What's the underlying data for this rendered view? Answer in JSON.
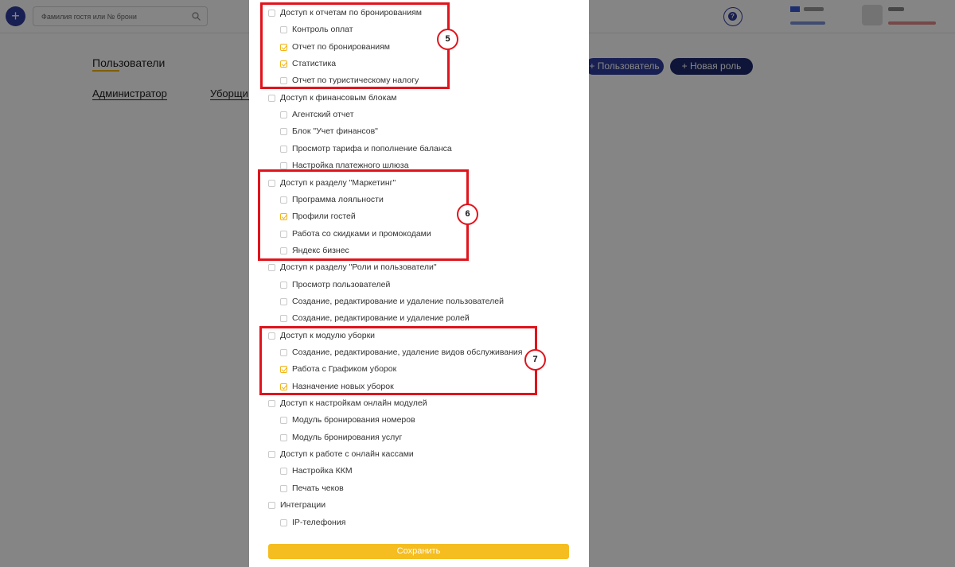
{
  "header": {
    "add_button": "+",
    "search_placeholder": "Фамилия гостя или № брони",
    "help_icon": "?"
  },
  "background": {
    "page_title": "Пользователи",
    "tabs": [
      "Администратор",
      "Уборщи"
    ],
    "add_user_button": "+ Пользователь",
    "new_role_button": "+ Новая роль"
  },
  "permissions": [
    {
      "label": "Доступ к отчетам по бронированиям",
      "checked": false
    },
    {
      "label": "Контроль оплат",
      "checked": false
    },
    {
      "label": "Отчет по бронированиям",
      "checked": true
    },
    {
      "label": "Статистика",
      "checked": true
    },
    {
      "label": "Отчет по туристическому налогу",
      "checked": false
    },
    {
      "label": "Доступ к финансовым блокам",
      "checked": false
    },
    {
      "label": "Агентский отчет",
      "checked": false
    },
    {
      "label": "Блок \"Учет финансов\"",
      "checked": false
    },
    {
      "label": "Просмотр тарифа и пополнение баланса",
      "checked": false
    },
    {
      "label": "Настройка платежного шлюза",
      "checked": false
    },
    {
      "label": "Доступ к разделу \"Маркетинг\"",
      "checked": false
    },
    {
      "label": "Программа лояльности",
      "checked": false
    },
    {
      "label": "Профили гостей",
      "checked": true
    },
    {
      "label": "Работа со скидками и промокодами",
      "checked": false
    },
    {
      "label": "Яндекс бизнес",
      "checked": false
    },
    {
      "label": "Доступ к разделу \"Роли и пользователи\"",
      "checked": false
    },
    {
      "label": "Просмотр пользователей",
      "checked": false
    },
    {
      "label": "Создание, редактирование и удаление пользователей",
      "checked": false
    },
    {
      "label": "Создание, редактирование и удаление ролей",
      "checked": false
    },
    {
      "label": "Доступ к модулю уборки",
      "checked": false
    },
    {
      "label": "Создание, редактирование, удаление видов обслуживания",
      "checked": false
    },
    {
      "label": "Работа с Графиком уборок",
      "checked": true
    },
    {
      "label": "Назначение новых уборок",
      "checked": true
    },
    {
      "label": "Доступ к настройкам онлайн модулей",
      "checked": false
    },
    {
      "label": "Модуль бронирования номеров",
      "checked": false
    },
    {
      "label": "Модуль бронирования услуг",
      "checked": false
    },
    {
      "label": "Доступ к работе с онлайн кассами",
      "checked": false
    },
    {
      "label": "Настройка ККМ",
      "checked": false
    },
    {
      "label": "Печать чеков",
      "checked": false
    },
    {
      "label": "Интеграции",
      "checked": false
    },
    {
      "label": "IP-телефония",
      "checked": false
    }
  ],
  "save_button": "Сохранить",
  "annotations": [
    "5",
    "6",
    "7"
  ]
}
